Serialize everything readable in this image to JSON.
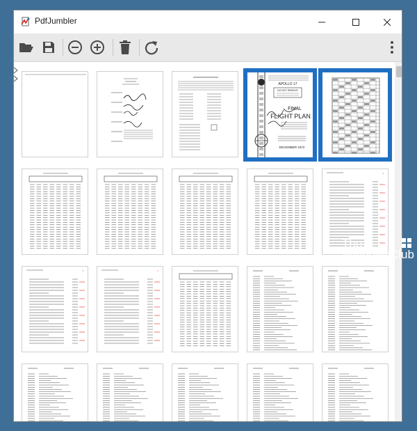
{
  "window": {
    "title": "PdfJumbler",
    "controls": {
      "minimize": "minimize",
      "maximize": "maximize",
      "close": "close"
    }
  },
  "toolbar": {
    "buttons": [
      {
        "name": "open-button",
        "icon": "folder-open-icon"
      },
      {
        "name": "save-button",
        "icon": "save-icon"
      },
      {
        "name": "zoom-out-button",
        "icon": "zoom-out-icon"
      },
      {
        "name": "zoom-in-button",
        "icon": "zoom-in-icon"
      },
      {
        "name": "delete-button",
        "icon": "trash-icon"
      },
      {
        "name": "rotate-button",
        "icon": "rotate-icon"
      },
      {
        "name": "more-button",
        "icon": "more-vertical-icon"
      }
    ]
  },
  "pages": [
    {
      "kind": "blank-lines",
      "selected": false
    },
    {
      "kind": "signature",
      "selected": false
    },
    {
      "kind": "form",
      "selected": false
    },
    {
      "kind": "cover",
      "selected": true,
      "text": [
        "DO NOT REMOVE",
        "APOLLO 17",
        "FINAL",
        "FLIGHT PLAN",
        "DECEMBER 1972"
      ]
    },
    {
      "kind": "grid",
      "selected": true
    },
    {
      "kind": "table",
      "selected": false
    },
    {
      "kind": "table",
      "selected": false
    },
    {
      "kind": "table",
      "selected": false
    },
    {
      "kind": "table",
      "selected": false
    },
    {
      "kind": "toc",
      "selected": false
    },
    {
      "kind": "toc",
      "selected": false
    },
    {
      "kind": "toc",
      "selected": false
    },
    {
      "kind": "table",
      "selected": false
    },
    {
      "kind": "list",
      "selected": false
    },
    {
      "kind": "list",
      "selected": false
    },
    {
      "kind": "list",
      "selected": false
    },
    {
      "kind": "list",
      "selected": false
    },
    {
      "kind": "list",
      "selected": false
    },
    {
      "kind": "list",
      "selected": false
    },
    {
      "kind": "list",
      "selected": false
    }
  ],
  "watermark": {
    "line1": "The",
    "line2": "WindowsClub"
  },
  "colors": {
    "selection": "#1f6fc2",
    "desktop": "#3f6f96",
    "accent_red": "#d9251d"
  }
}
